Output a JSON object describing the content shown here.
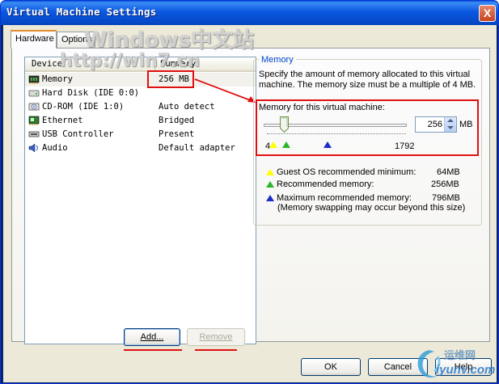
{
  "window": {
    "title": "Virtual Machine Settings",
    "close": "X"
  },
  "tabs": [
    {
      "label": "Hardware"
    },
    {
      "label": "Options"
    }
  ],
  "device_list": {
    "columns": {
      "device": "Device",
      "summary": "Summary"
    },
    "rows": [
      {
        "name": "Memory",
        "summary": "256 MB",
        "icon": "memory-chip-icon"
      },
      {
        "name": "Hard Disk (IDE 0:0)",
        "summary": "",
        "icon": "hard-disk-icon"
      },
      {
        "name": "CD-ROM (IDE 1:0)",
        "summary": "Auto detect",
        "icon": "cdrom-icon"
      },
      {
        "name": "Ethernet",
        "summary": "Bridged",
        "icon": "network-card-icon"
      },
      {
        "name": "USB Controller",
        "summary": "Present",
        "icon": "usb-icon"
      },
      {
        "name": "Audio",
        "summary": "Default adapter",
        "icon": "speaker-icon"
      }
    ],
    "selected": "Memory"
  },
  "list_buttons": {
    "add": "Add...",
    "remove": "Remove"
  },
  "memory": {
    "group_title": "Memory",
    "description": "Specify the amount of memory allocated to this virtual machine. The memory size must be a multiple of 4 MB.",
    "field_label": "Memory for this virtual machine:",
    "value": "256",
    "unit": "MB",
    "slider_min_label": "4",
    "slider_max_label": "1792",
    "slider": {
      "min": 4,
      "max": 1792,
      "value": 256
    },
    "legend": [
      {
        "label": "Guest OS recommended minimum:",
        "value": "64MB",
        "color": "#ffff00"
      },
      {
        "label": "Recommended memory:",
        "value": "256MB",
        "color": "#2db52d"
      },
      {
        "label": "Maximum recommended memory:",
        "value": "796MB",
        "color": "#1a2dc8"
      }
    ],
    "note": "(Memory swapping may occur beyond this size)"
  },
  "dialog_buttons": {
    "ok": "OK",
    "cancel": "Cancel",
    "help": "Help"
  },
  "watermarks": {
    "main": "Windows中文站",
    "url": "http://win7.cn",
    "corner_cn": "运维网",
    "corner_en": "iyunv.com"
  },
  "colors": {
    "titlebar": "#0a58e0",
    "face": "#ece9d8",
    "highlight": "#e01010",
    "group_title": "#0046d5"
  }
}
